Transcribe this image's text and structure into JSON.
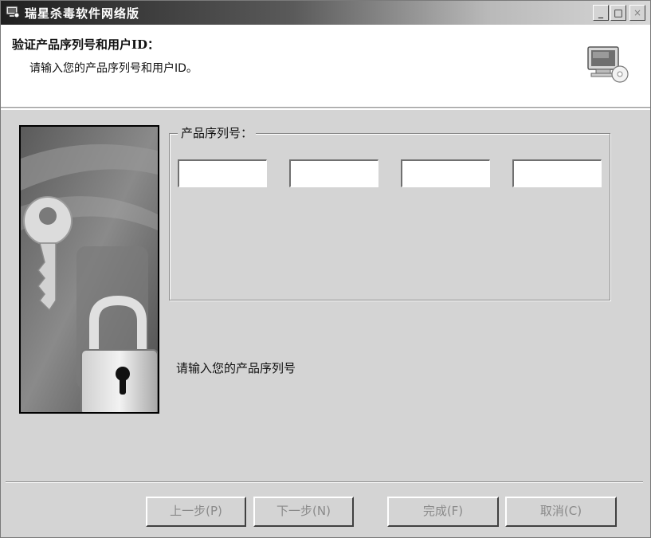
{
  "window": {
    "title": "瑞星杀毒软件网络版",
    "controls": {
      "minimize": "_",
      "maximize": "□",
      "close": "×"
    }
  },
  "header": {
    "title": "验证产品序列号和用户ID：",
    "subtitle": "请输入您的产品序列号和用户ID。",
    "icon": "computer-cd-icon"
  },
  "side_image": {
    "icon": "key-and-padlock-icon"
  },
  "serial_group": {
    "label": "产品序列号：",
    "fields": [
      {
        "value": "",
        "placeholder": ""
      },
      {
        "value": "",
        "placeholder": ""
      },
      {
        "value": "",
        "placeholder": ""
      },
      {
        "value": "",
        "placeholder": ""
      }
    ]
  },
  "prompt": "请输入您的产品序列号",
  "buttons": {
    "back": "上一步(P)",
    "next": "下一步(N)",
    "finish": "完成(F)",
    "cancel": "取消(C)"
  }
}
